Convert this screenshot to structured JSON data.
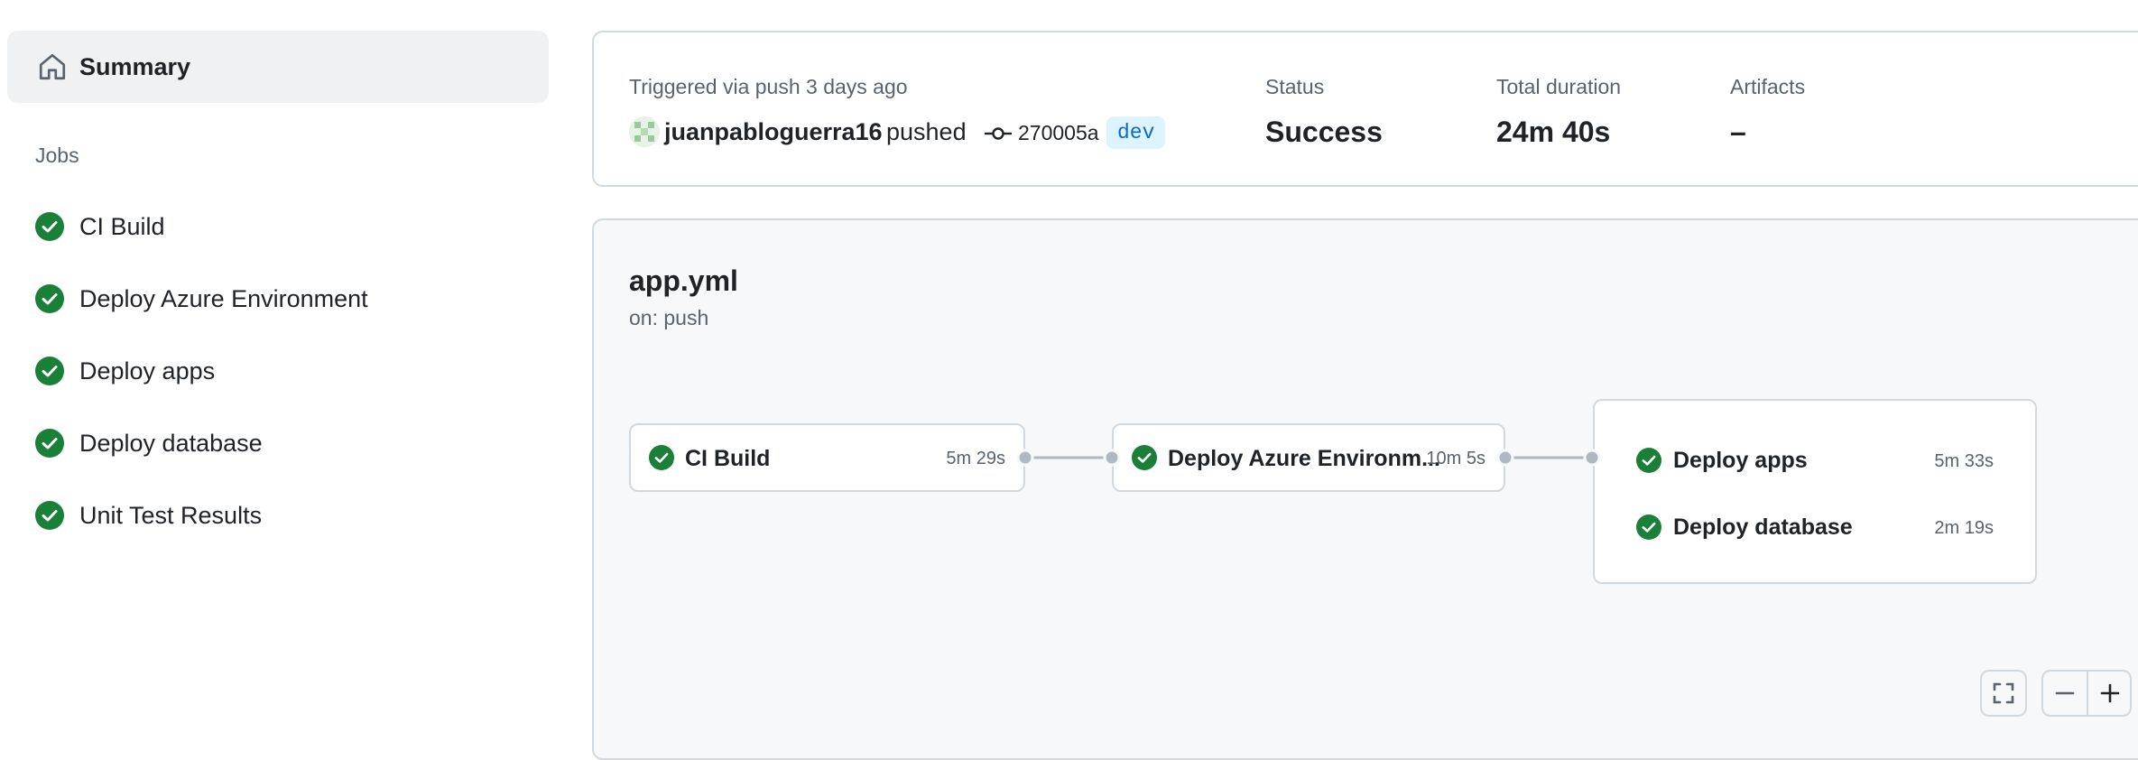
{
  "sidebar": {
    "summary_label": "Summary",
    "jobs_heading": "Jobs",
    "jobs": [
      {
        "label": "CI Build"
      },
      {
        "label": "Deploy Azure Environment"
      },
      {
        "label": "Deploy apps"
      },
      {
        "label": "Deploy database"
      },
      {
        "label": "Unit Test Results"
      }
    ]
  },
  "run_summary": {
    "trigger_text": "Triggered via push 3 days ago",
    "actor": "juanpabloguerra16",
    "action": "pushed",
    "commit_sha": "270005a",
    "branch": "dev",
    "status_label": "Status",
    "status_value": "Success",
    "duration_label": "Total duration",
    "duration_value": "24m 40s",
    "artifacts_label": "Artifacts",
    "artifacts_value": "–"
  },
  "workflow": {
    "name": "app.yml",
    "trigger": "on: push",
    "nodes": [
      {
        "label": "CI Build",
        "duration": "5m 29s"
      },
      {
        "label": "Deploy Azure Environm...",
        "duration": "10m 5s"
      }
    ],
    "group": [
      {
        "label": "Deploy apps",
        "duration": "5m 33s"
      },
      {
        "label": "Deploy database",
        "duration": "2m 19s"
      }
    ]
  },
  "icons": {
    "success": "check-circle-fill-icon",
    "home": "home-icon",
    "commit": "git-commit-icon",
    "fullscreen": "fullscreen-icon",
    "zoom_out": "zoom-out-icon",
    "zoom_in": "zoom-in-icon"
  },
  "colors": {
    "success": "#1a7f37",
    "branch_bg": "#ddf4ff",
    "branch_fg": "#0969da",
    "muted_text": "#59636e",
    "border": "#d1d9e0",
    "graph_bg": "#f6f8fa"
  }
}
